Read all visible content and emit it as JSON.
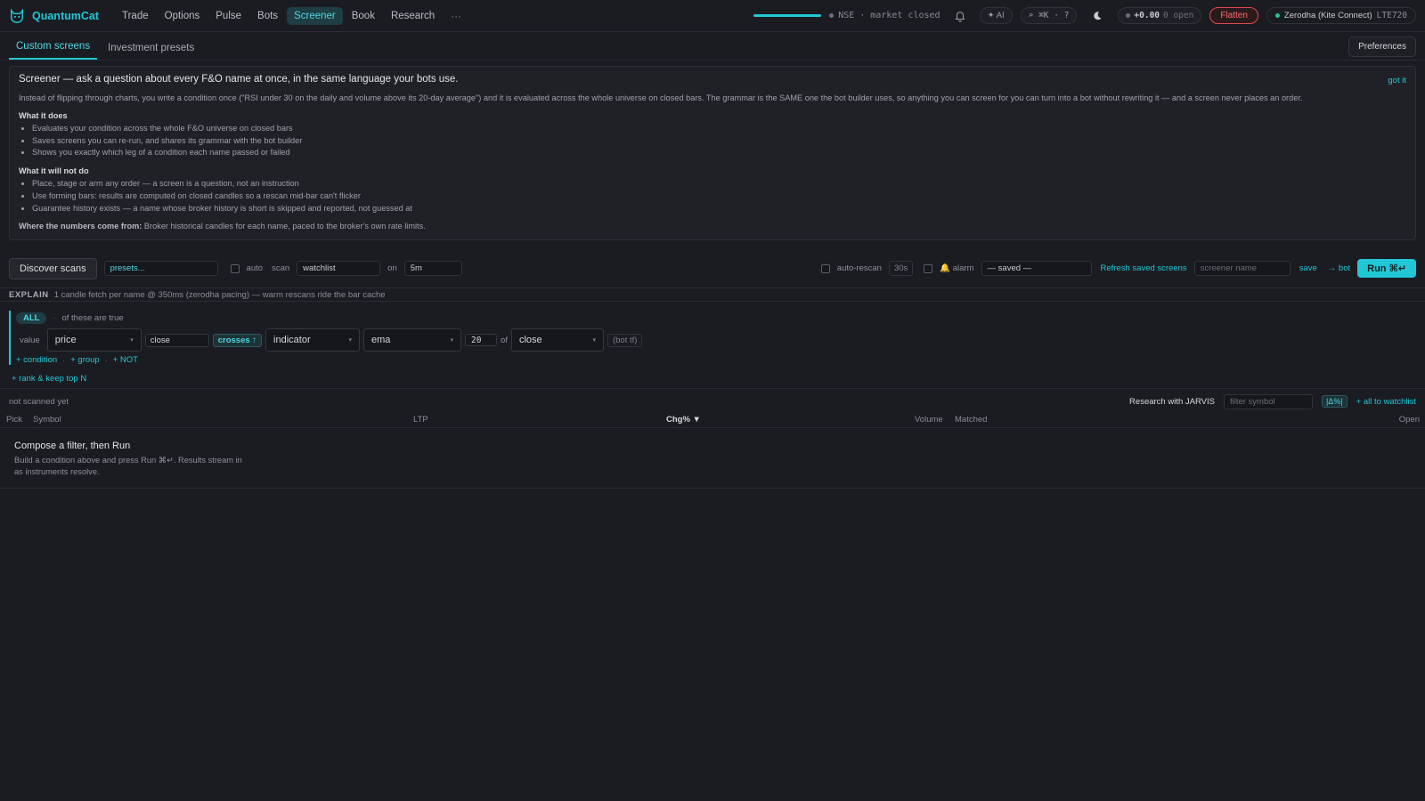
{
  "app": {
    "name": "QuantumCat"
  },
  "nav": {
    "items": [
      "Trade",
      "Options",
      "Pulse",
      "Bots",
      "Screener",
      "Book",
      "Research"
    ],
    "active": "Screener",
    "more": "···"
  },
  "status": {
    "progress": 1.0,
    "exchange": "NSE · market closed",
    "ai_label": "✦ AI",
    "cmdk_label": "⌕ ⌘K · ?",
    "pnl": "+0.00",
    "open_count": "0 open",
    "flatten_label": "Flatten",
    "broker": "Zerodha (Kite Connect)",
    "account": "LTE720"
  },
  "subtabs": {
    "items": [
      "Custom screens",
      "Investment presets"
    ],
    "active": "Custom screens",
    "prefs": "Preferences"
  },
  "intro": {
    "title": "Screener — ask a question about every F&O name at once, in the same language your bots use.",
    "dismiss": "got it",
    "body": "Instead of flipping through charts, you write a condition once (\"RSI under 30 on the daily and volume above its 20-day average\") and it is evaluated across the whole universe on closed bars. The grammar is the SAME one the bot builder uses, so anything you can screen for you can turn into a bot without rewriting it — and a screen never places an order.",
    "does_title": "What it does",
    "does": [
      "Evaluates your condition across the whole F&O universe on closed bars",
      "Saves screens you can re-run, and shares its grammar with the bot builder",
      "Shows you exactly which leg of a condition each name passed or failed"
    ],
    "not_title": "What it will not do",
    "not": [
      "Place, stage or arm any order — a screen is a question, not an instruction",
      "Use forming bars: results are computed on closed candles so a rescan mid-bar can't flicker",
      "Guarantee history exists — a name whose broker history is short is skipped and reported, not guessed at"
    ],
    "source_label": "Where the numbers come from:",
    "source_text": "Broker historical candles for each name, paced to the broker's own rate limits."
  },
  "toolbar": {
    "discover": "Discover scans",
    "presets_placeholder": "presets...",
    "auto_label": "auto",
    "scan_label": "scan",
    "scan_value": "watchlist",
    "on_label": "on",
    "tf_value": "5m",
    "autorescan_label": "auto-rescan",
    "interval": "30s",
    "alarm_label": "🔔 alarm",
    "saved_value": "— saved —",
    "refresh": "Refresh saved screens",
    "name_placeholder": "screener name",
    "save": "save",
    "to_bot": "→ bot",
    "run": "Run ⌘↵"
  },
  "explain": {
    "label": "EXPLAIN",
    "text": "1 candle fetch per name @ 350ms (zerodha pacing) — warm rescans ride the bar cache"
  },
  "builder": {
    "mode": "ALL",
    "mode_text": "of these are true",
    "value_label": "value",
    "field1": "price",
    "field1_sub": "close",
    "op": "crosses ↑",
    "field2": "indicator",
    "indicator": "ema",
    "period": "20",
    "of_label": "of",
    "source": "close",
    "tf_hint": "(bot tf)",
    "add_condition": "+ condition",
    "add_group": "+ group",
    "add_not": "+ NOT",
    "rank": "+ rank & keep top N"
  },
  "results": {
    "status": "not scanned yet",
    "jarvis": "Research with JARVIS",
    "filter_placeholder": "filter symbol",
    "abs_pct": "|Δ%|",
    "all_watchlist": "+ all to watchlist",
    "columns": {
      "pick": "Pick",
      "symbol": "Symbol",
      "ltp": "LTP",
      "chg": "Chg% ▼",
      "volume": "Volume",
      "matched": "Matched",
      "open": "Open"
    },
    "empty_title": "Compose a filter, then Run",
    "empty_text": "Build a condition above and press Run ⌘↵. Results stream in as instruments resolve."
  }
}
